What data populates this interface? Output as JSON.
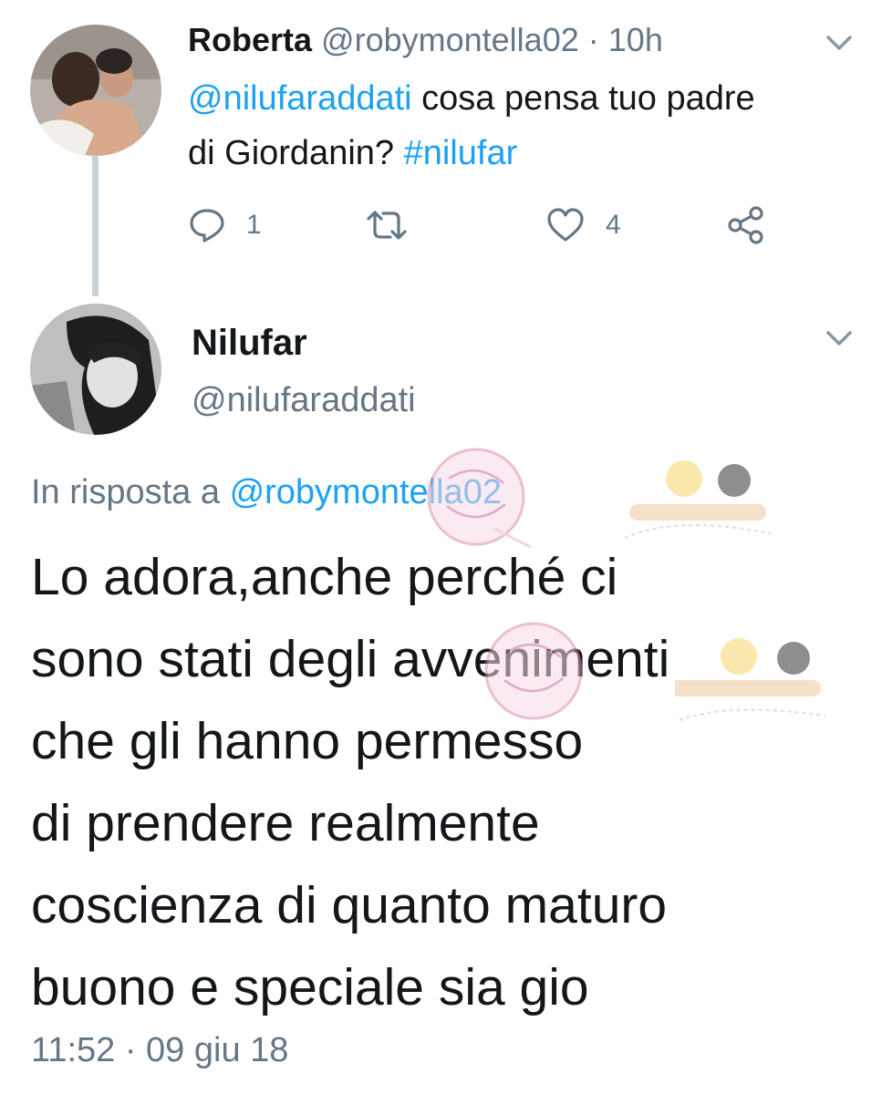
{
  "tweet1": {
    "name": "Roberta",
    "handle": "@robymontella02",
    "separator": "·",
    "time": "10h",
    "mention": "@nilufaraddati",
    "text_part1": " cosa pensa tuo padre di Giordanin? ",
    "hashtag": "#nilufar",
    "actions": {
      "reply_icon": "reply-icon",
      "reply_count": "1",
      "retweet_icon": "retweet-icon",
      "like_icon": "heart-icon",
      "like_count": "4",
      "share_icon": "share-icon"
    }
  },
  "tweet2": {
    "name": "Nilufar",
    "handle": "@nilufaraddati",
    "reply_prefix": "In risposta a ",
    "reply_handle": "@robymontella02",
    "text": "Lo adora,anche perché ci\nsono stati degli avvenimenti\nche gli hanno permesso\ndi prendere realmente\ncoscienza di quanto maturo\nbuono e speciale sia gio",
    "timestamp": "11:52 · 09 giu 18"
  },
  "colors": {
    "link": "#1da1f2",
    "secondary_text": "#657786",
    "thread_line": "#c9d2d9"
  }
}
